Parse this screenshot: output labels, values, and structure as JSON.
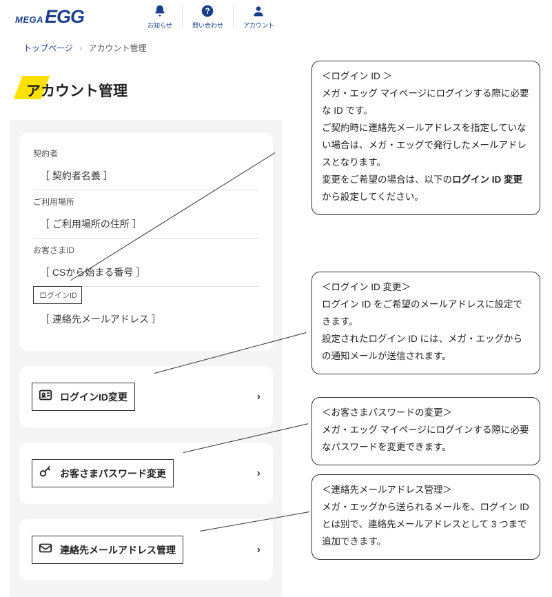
{
  "brand": {
    "mega": "MEGA",
    "egg": "EGG"
  },
  "header_nav": {
    "notifications": "お知らせ",
    "contact": "問い合わせ",
    "account": "アカウント"
  },
  "breadcrumb": {
    "home": "トップページ",
    "sep": "›",
    "current": "アカウント管理"
  },
  "page_title": "アカウント管理",
  "info": {
    "contractor_label": "契約者",
    "contractor_value": "［ 契約者名義 ］",
    "location_label": "ご利用場所",
    "location_value": "［ ご利用場所の住所 ］",
    "customer_id_label": "お客さまID",
    "customer_id_value": "［ CSから始まる番号 ］",
    "login_id_label": "ログインID",
    "login_id_value": "［ 連絡先メールアドレス ］"
  },
  "menu": {
    "login_id_change": "ログインID変更",
    "password_change": "お客さまパスワード変更",
    "mail_manage": "連絡先メールアドレス管理"
  },
  "callouts": {
    "login_id": {
      "title": "＜ログイン ID ＞",
      "line1": "メガ・エッグ マイページにログインする際に必要な ID です。",
      "line2": "ご契約時に連絡先メールアドレスを指定していない場合は、メガ・エッグで発行したメールアドレスとなります。",
      "line3_a": "変更をご希望の場合は、以下の",
      "line3_b": "ログイン ID 変更",
      "line3_c": "から設定してください。"
    },
    "login_id_change": {
      "title": "＜ログイン ID 変更＞",
      "line1": "ログイン ID をご希望のメールアドレスに設定できます。",
      "line2": "設定されたログイン ID には、メガ・エッグからの通知メールが送信されます。"
    },
    "password": {
      "title": "＜お客さまパスワードの変更＞",
      "line1": "メガ・エッグ マイページにログインする際に必要なパスワードを変更できます。"
    },
    "mail": {
      "title": "＜連絡先メールアドレス管理＞",
      "line1": "メガ・エッグから送られるメールを、ログイン ID とは別で、連絡先メールアドレスとして 3 つまで追加できます。"
    }
  }
}
